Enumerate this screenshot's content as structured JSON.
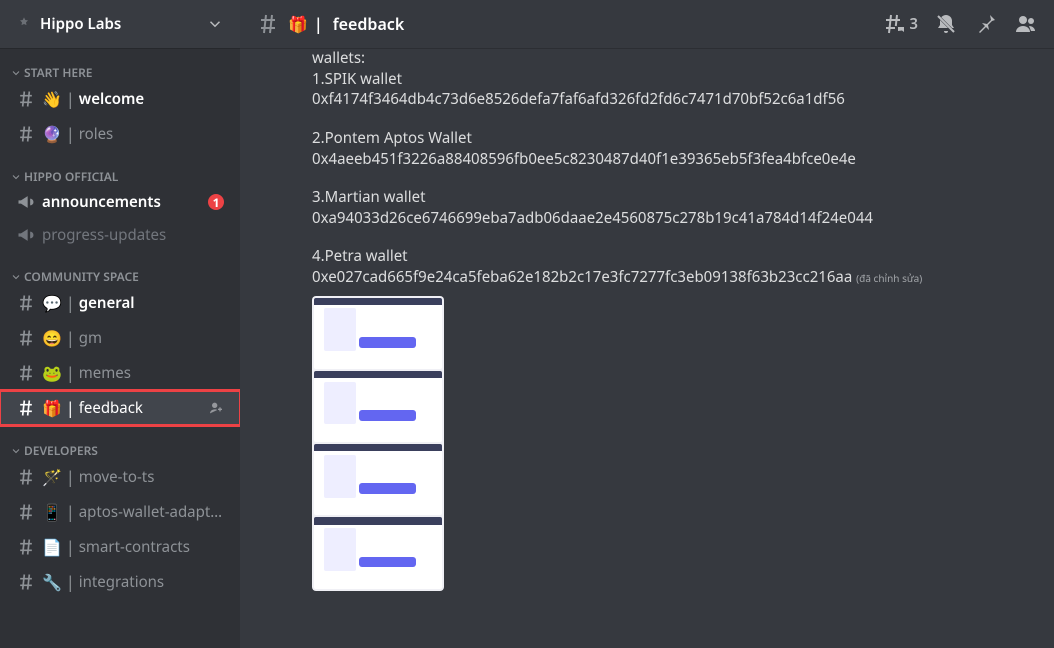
{
  "server": {
    "name": "Hippo Labs"
  },
  "categories": [
    {
      "name": "START HERE",
      "channels": [
        {
          "emoji": "👋",
          "name": "welcome",
          "type": "text",
          "bold": true
        },
        {
          "emoji": "🔮",
          "name": "roles",
          "type": "text"
        }
      ]
    },
    {
      "name": "HIPPO OFFICIAL",
      "channels": [
        {
          "emoji": "",
          "name": "announcements",
          "type": "announce",
          "bold": true,
          "badge": "1"
        },
        {
          "emoji": "",
          "name": "progress-updates",
          "type": "announce",
          "muted": true
        }
      ]
    },
    {
      "name": "COMMUNITY SPACE",
      "channels": [
        {
          "emoji": "💬",
          "name": "general",
          "type": "text",
          "bold": true
        },
        {
          "emoji": "😄",
          "name": "gm",
          "type": "text"
        },
        {
          "emoji": "🐸",
          "name": "memes",
          "type": "text"
        },
        {
          "emoji": "🎁",
          "name": "feedback",
          "type": "text",
          "active": true,
          "highlighted": true,
          "invite": true
        }
      ]
    },
    {
      "name": "DEVELOPERS",
      "channels": [
        {
          "emoji": "🪄",
          "name": "move-to-ts",
          "type": "text"
        },
        {
          "emoji": "📱",
          "name": "aptos-wallet-adapter",
          "type": "text"
        },
        {
          "emoji": "📄",
          "name": "smart-contracts",
          "type": "text"
        },
        {
          "emoji": "🔧",
          "name": "integrations",
          "type": "text"
        }
      ]
    }
  ],
  "header": {
    "emoji": "🎁",
    "title": "feedback",
    "threads": "3"
  },
  "message": {
    "lines": [
      "wallets:",
      "1.SPIK wallet",
      "0xf4174f3464db4c73d6e8526defa7faf6afd326fd2fd6c7471d70bf52c6a1df56",
      "",
      "2.Pontem Aptos Wallet",
      "0x4aeeb451f3226a88408596fb0ee5c8230487d40f1e39365eb5f3fea4bfce0e4e",
      "",
      "3.Martian wallet",
      "0xa94033d26ce6746699eba7adb06daae2e4560875c278b19c41a784d14f24e044",
      "",
      "4.Petra wallet"
    ],
    "last_line": "0xe027cad665f9e24ca5feba62e182b2c17e3fc7277fc3eb09138f63b23cc216aa",
    "edited": "(đã chỉnh sửa)"
  }
}
